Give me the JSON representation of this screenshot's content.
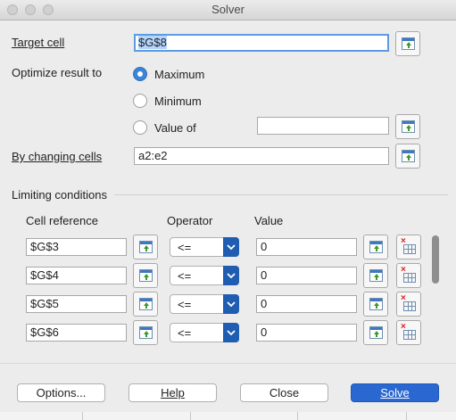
{
  "window": {
    "title": "Solver"
  },
  "target": {
    "label": "Target cell",
    "value": "$G$8"
  },
  "optimize": {
    "label": "Optimize result to",
    "options": [
      "Maximum",
      "Minimum",
      "Value of"
    ],
    "selected": "Maximum",
    "value_of": ""
  },
  "changing": {
    "label": "By changing cells",
    "value": "a2:e2"
  },
  "limits": {
    "label": "Limiting conditions",
    "col_cell": "Cell reference",
    "col_operator": "Operator",
    "col_value": "Value",
    "rows": [
      {
        "cell": "$G$3",
        "operator": "<=",
        "value": "0"
      },
      {
        "cell": "$G$4",
        "operator": "<=",
        "value": "0"
      },
      {
        "cell": "$G$5",
        "operator": "<=",
        "value": "0"
      },
      {
        "cell": "$G$6",
        "operator": "<=",
        "value": "0"
      }
    ]
  },
  "buttons": {
    "options": "Options...",
    "help": "Help",
    "close": "Close",
    "solve": "Solve"
  },
  "colors": {
    "accent": "#2a67d1",
    "focus": "#5b9be2"
  }
}
